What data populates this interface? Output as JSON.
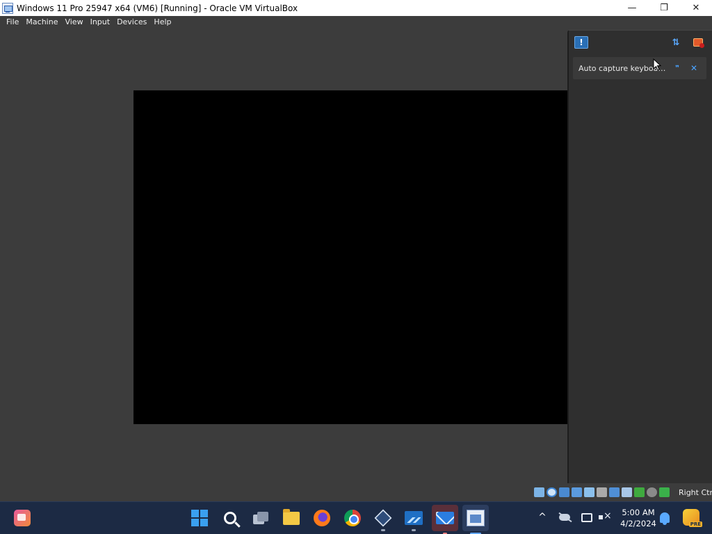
{
  "window": {
    "title": "Windows 11 Pro 25947 x64 (VM6) [Running] - Oracle VM VirtualBox",
    "minimize_glyph": "—",
    "restore_glyph": "❐",
    "close_glyph": "✕"
  },
  "menubar": {
    "items": [
      "File",
      "Machine",
      "View",
      "Input",
      "Devices",
      "Help"
    ]
  },
  "notification_center": {
    "sort_glyph": "⇅",
    "items": [
      {
        "text": "Auto capture keyboard ...",
        "action_glyph": "❞",
        "close_glyph": "✕"
      }
    ]
  },
  "statusbar": {
    "host_key_label": "Right Ctrl"
  },
  "taskbar": {
    "tray_chevron": "^",
    "clock": {
      "time": "5:00 AM",
      "date": "4/2/2024"
    },
    "copilot_badge": "PRE"
  },
  "colors": {
    "titlebar_bg": "#ffffff",
    "frame_bg": "#3c3c3c",
    "vm_screen_bg": "#000000",
    "taskbar_bg": "#1c2a44",
    "accent": "#4aa3ff"
  }
}
